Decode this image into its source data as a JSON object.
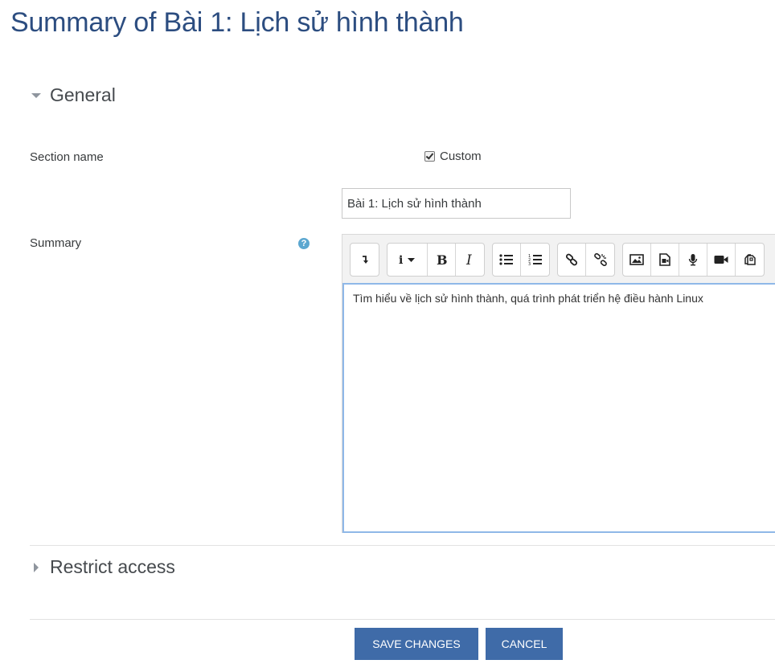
{
  "page": {
    "title": "Summary of Bài 1: Lịch sử hình thành"
  },
  "sections": {
    "general": {
      "title": "General",
      "expanded": true
    },
    "restrict": {
      "title": "Restrict access",
      "expanded": false
    }
  },
  "form": {
    "section_name_label": "Section name",
    "custom_label": "Custom",
    "custom_checked": true,
    "section_name_value": "Bài 1: Lịch sử hình thành",
    "summary_label": "Summary",
    "help_glyph": "?",
    "summary_text": "Tìm hiểu về lịch sử hình thành, quá trình phát triển hệ điều hành Linux"
  },
  "toolbar": {
    "groups": [
      [
        "collapse-icon"
      ],
      [
        "style-dropdown-icon",
        "bold-icon",
        "italic-icon"
      ],
      [
        "unordered-list-icon",
        "ordered-list-icon"
      ],
      [
        "link-icon",
        "unlink-icon"
      ],
      [
        "image-icon",
        "media-icon",
        "record-audio-icon",
        "record-video-icon",
        "manage-files-icon"
      ]
    ]
  },
  "buttons": {
    "save": "SAVE CHANGES",
    "cancel": "CANCEL"
  },
  "colors": {
    "title": "#2c4d80",
    "primary_button": "#3f6ba8",
    "help_icon": "#5ba7d0",
    "editor_focus_border": "#8fb8e8"
  }
}
